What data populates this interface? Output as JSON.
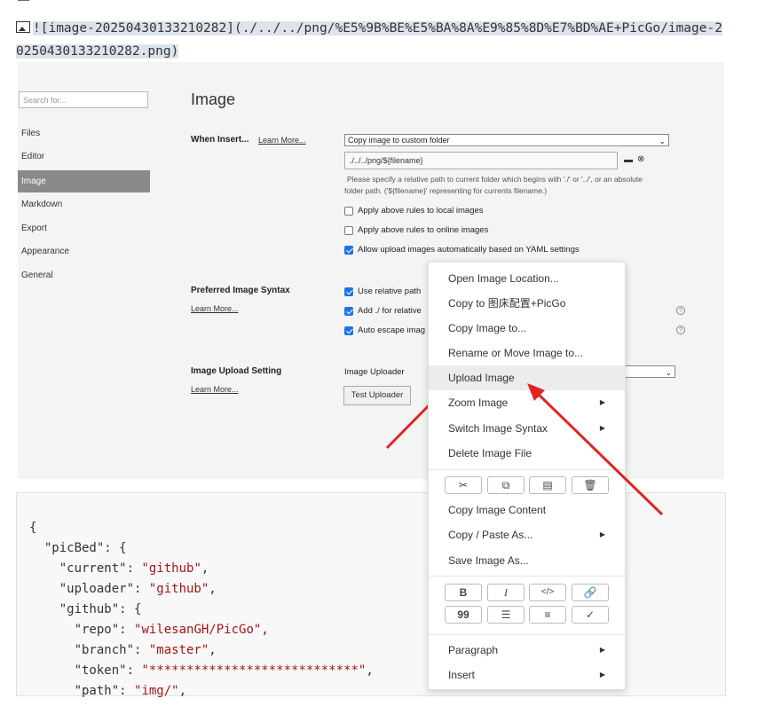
{
  "document": {
    "image_markdown_line1": "![image-20250430133210282](./../../png/%E5%9B%BE%E5%BA%8A%E9%85%8D%E7%BD%AE+PicGo/image-2",
    "image_markdown_line2": "0250430133210282.png)"
  },
  "settings": {
    "search_placeholder": "Search for...",
    "nav": [
      "Files",
      "Editor",
      "Image",
      "Markdown",
      "Export",
      "Appearance",
      "General"
    ],
    "active_nav": "Image",
    "title": "Image",
    "when_insert_label": "When Insert...",
    "learn_more": "Learn More...",
    "insert_action": "Copy image to custom folder",
    "folder_path": "./../../png/${filename}",
    "help_line1": "Please specify a relative path to current folder which begins with './' or '../', or an absolute",
    "help_line2": "folder path. ('${filename}' representing for currents filename.)",
    "checkbox_local": "Apply above rules to local images",
    "checkbox_online": "Apply above rules to online images",
    "checkbox_yaml": "Allow upload images automatically based on YAML settings",
    "preferred_syntax_label": "Preferred Image Syntax",
    "syntax_relative": "Use relative path",
    "syntax_add": "Add ./ for relative",
    "syntax_escape": "Auto escape imag",
    "upload_setting_label": "Image Upload Setting",
    "image_uploader_label": "Image Uploader",
    "test_uploader": "Test Uploader"
  },
  "code": {
    "l1": "{",
    "l2_key": "  \"picBed\": {",
    "l3_key": "    \"current\": ",
    "l3_val": "\"github\"",
    "l4_key": "    \"uploader\": ",
    "l4_val": "\"github\"",
    "l5_key": "    \"github\": {",
    "l6_key": "      \"repo\": ",
    "l6_val": "\"wilesanGH/PicGo\"",
    "l7_key": "      \"branch\": ",
    "l7_val": "\"master\"",
    "l8_key": "      \"token\": ",
    "l8_val": "\"****************************\"",
    "l9_key": "      \"path\": ",
    "l9_val": "\"img/\"",
    "comma": ","
  },
  "context_menu": {
    "items_top": [
      "Open Image Location...",
      "Copy to 图床配置+PicGo",
      "Copy Image to...",
      "Rename or Move Image to...",
      "Upload Image",
      "Zoom Image",
      "Switch Image Syntax",
      "Delete Image File"
    ],
    "hovered": "Upload Image",
    "items_mid": [
      "Copy Image Content",
      "Copy / Paste As...",
      "Save Image As..."
    ],
    "items_bottom": [
      "Paragraph",
      "Insert"
    ],
    "format_bold": "B",
    "format_italic": "I",
    "format_code": "</>",
    "format_quote": "99"
  },
  "colors": {
    "annotation_arrow": "#e02424",
    "checkbox": "#1a73e8",
    "hover": "#ececec"
  }
}
